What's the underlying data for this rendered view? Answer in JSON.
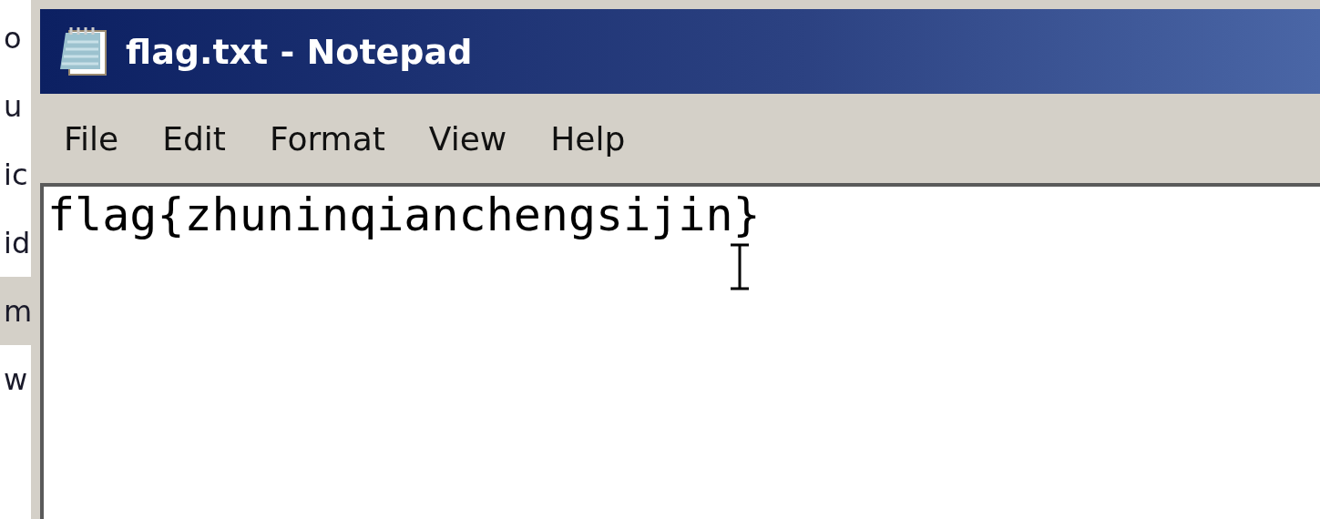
{
  "background_list": {
    "items": [
      {
        "label": "o",
        "selected": false
      },
      {
        "label": "u",
        "selected": false
      },
      {
        "label": "ic",
        "selected": false
      },
      {
        "label": "id",
        "selected": false
      },
      {
        "label": "m",
        "selected": true
      },
      {
        "label": "w",
        "selected": false
      }
    ]
  },
  "window": {
    "title": "flag.txt - Notepad"
  },
  "menu": [
    "File",
    "Edit",
    "Format",
    "View",
    "Help"
  ],
  "editor": {
    "text": "flag{zhuninqianchengsijin}"
  }
}
